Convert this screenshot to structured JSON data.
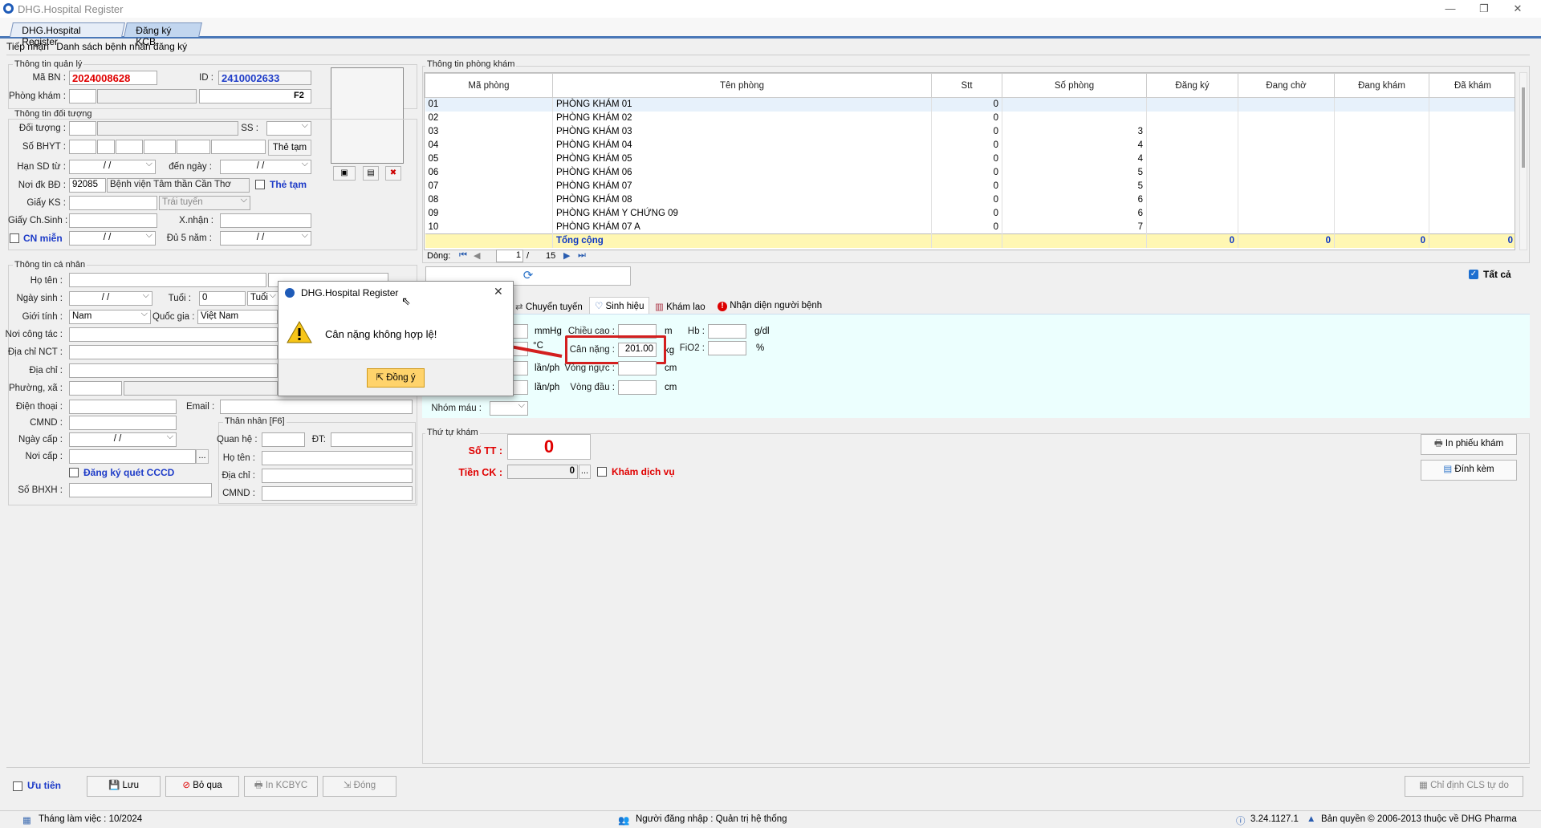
{
  "window": {
    "title": "DHG.Hospital Register",
    "min": "—",
    "max": "❐",
    "close": "✕"
  },
  "app_tabs": [
    "DHG.Hospital Register",
    "Đăng ký KCB"
  ],
  "sub_tabs": [
    "Tiếp nhận",
    "Danh sách bệnh nhân đăng ký"
  ],
  "mgmt": {
    "group": "Thông tin quản lý",
    "ma_bn_label": "Mã BN :",
    "ma_bn": "2024008628",
    "id_label": "ID :",
    "id": "2410002633",
    "phong_kham_label": "Phòng khám :",
    "f2": "F2"
  },
  "obj": {
    "group": "Thông tin đối tượng",
    "doi_tuong": "Đối tượng :",
    "ss": "SS :",
    "so_bhyt": "Số BHYT :",
    "the_tam_btn": "Thẻ tạm",
    "han_sd": "Hạn SD từ :",
    "den_ngay": "đến ngày :",
    "date_blank": "/     /",
    "noi_dk": "Nơi đk BĐ :",
    "noi_dk_code": "92085",
    "noi_dk_name": "Bệnh viện Tâm thần Cần Thơ",
    "the_tam_chk": "Thẻ tạm",
    "giay_ks": "Giấy KS :",
    "trai_tuyen": "Trái tuyến",
    "giay_chsinh": "Giấy Ch.Sinh :",
    "xnhan": "X.nhận :",
    "cn_mien": "CN miễn",
    "du5nam": "Đủ 5 năm :"
  },
  "personal": {
    "group": "Thông tin cá nhân",
    "ho_ten": "Họ tên :",
    "ngay_sinh": "Ngày sinh :",
    "tuoi": "Tuổi :",
    "tuoi_val": "0",
    "tuoi_unit": "Tuổi",
    "gioi_tinh": "Giới tính :",
    "gioi_tinh_val": "Nam",
    "quoc_gia": "Quốc gia :",
    "quoc_gia_val": "Việt Nam",
    "noi_cong_tac": "Nơi công tác :",
    "dia_chi_nct": "Địa chỉ  NCT :",
    "dia_chi": "Địa chỉ :",
    "phuong_xa": "Phường, xã :",
    "dien_thoai": "Điện thoại :",
    "email": "Email :",
    "cmnd": "CMND :",
    "ngay_cap": "Ngày cấp :",
    "noi_cap": "Nơi cấp :",
    "dang_ky_cccd": "Đăng ký quét CCCD",
    "so_bhxh": "Số BHXH :",
    "ellipsis": "..."
  },
  "than_nhan": {
    "group": "Thân nhân [F6]",
    "quan_he": "Quan hệ :",
    "dt": "ĐT:",
    "ho_ten": "Họ tên :",
    "dia_chi": "Địa chỉ :",
    "cmnd": "CMND :"
  },
  "rooms": {
    "group": "Thông tin phòng khám",
    "columns": [
      "Mã phòng",
      "Tên phòng",
      "Stt",
      "Số phòng",
      "Đăng ký",
      "Đang chờ",
      "Đang khám",
      "Đã khám"
    ],
    "rows": [
      [
        "01",
        "PHÒNG KHÁM 01",
        "0",
        "",
        "",
        "",
        "",
        ""
      ],
      [
        "02",
        "PHÒNG KHÁM 02",
        "0",
        "",
        "",
        "",
        "",
        ""
      ],
      [
        "03",
        "PHÒNG KHÁM 03",
        "0",
        "3",
        "",
        "",
        "",
        ""
      ],
      [
        "04",
        "PHÒNG KHÁM 04",
        "0",
        "4",
        "",
        "",
        "",
        ""
      ],
      [
        "05",
        "PHÒNG KHÁM 05",
        "0",
        "4",
        "",
        "",
        "",
        ""
      ],
      [
        "06",
        "PHÒNG KHÁM 06",
        "0",
        "5",
        "",
        "",
        "",
        ""
      ],
      [
        "07",
        "PHÒNG KHÁM 07",
        "0",
        "5",
        "",
        "",
        "",
        ""
      ],
      [
        "08",
        "PHÒNG KHÁM 08",
        "0",
        "6",
        "",
        "",
        "",
        ""
      ],
      [
        "09",
        "PHÒNG KHÁM Y CHỨNG 09",
        "0",
        "6",
        "",
        "",
        "",
        ""
      ],
      [
        "10",
        "PHÒNG KHÁM 07 A",
        "0",
        "7",
        "",
        "",
        "",
        ""
      ]
    ],
    "total_label": "Tổng cộng",
    "totals": [
      "0",
      "0",
      "0",
      "0"
    ],
    "pager_label": "Dòng:",
    "page": "1",
    "page_sep": "/",
    "page_total": "15",
    "tat_ca": "Tất cả"
  },
  "vital_tabs": [
    "Chuyển tuyến",
    "Sinh hiệu",
    "Khám lao",
    "Nhận diện người bệnh"
  ],
  "vitals": {
    "mmhg": "mmHg",
    "degc": "°C",
    "lanph1": "lần/ph",
    "lanph2": "lần/ph",
    "chieu_cao": "Chiều cao :",
    "m": "m",
    "can_nang": "Cân nặng :",
    "can_nang_val": "201.00",
    "kg": "kg",
    "vong_nguc": "Vòng ngực :",
    "cm1": "cm",
    "vong_dau": "Vòng đầu :",
    "cm2": "cm",
    "hb": "Hb :",
    "gdl": "g/dl",
    "fio2": "FiO2 :",
    "pct": "%",
    "nhom_mau": "Nhóm máu :"
  },
  "queue": {
    "group": "Thứ tự khám",
    "so_tt_label": "Số TT :",
    "so_tt": "0",
    "tien_ck_label": "Tiền CK :",
    "tien_ck": "0",
    "ellipsis": "...",
    "kham_dich_vu": "Khám dịch vụ",
    "in_phieu": "In phiếu khám",
    "dinh_kem": "Đính kèm"
  },
  "dialog": {
    "title": "DHG.Hospital Register",
    "message": "Cân nặng không hợp lệ!",
    "ok": "Đồng ý",
    "close": "✕"
  },
  "footer": {
    "uu_tien": "Ưu tiên",
    "luu": "Lưu",
    "bo_qua": "Bỏ qua",
    "in_kcbyc": "In KCBYC",
    "dong": "Đóng",
    "chi_dinh": "Chỉ định CLS tự do"
  },
  "status": {
    "thang": "Tháng làm việc : 10/2024",
    "user": "Người đăng nhập : Quản trị hệ thống",
    "version": "3.24.1127.1",
    "copyright": "Bản quyền © 2006-2013 thuộc về DHG Pharma"
  },
  "colors": {
    "accent": "#4a78b8",
    "error_red": "#e00000",
    "highlight_box": "#d31f1f",
    "vital_bg": "#ecfffe",
    "total_bg": "#fff7b3"
  }
}
